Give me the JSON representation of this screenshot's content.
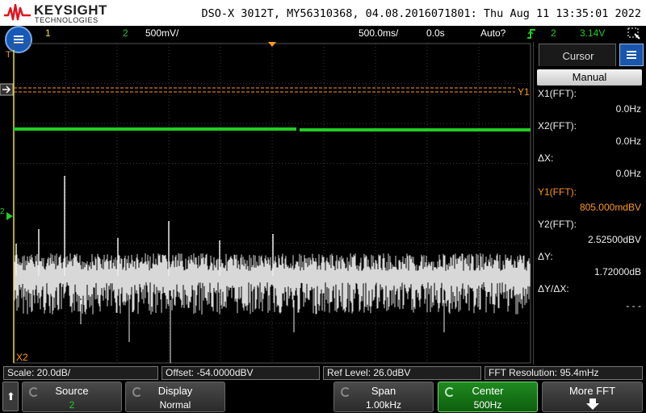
{
  "header": {
    "brand": "KEYSIGHT",
    "brand_sub": "TECHNOLOGIES",
    "title": "DSO-X 3012T, MY56310368, 04.08.2016071801: Thu Aug 11 13:35:01 2022"
  },
  "status": {
    "ch1_num": "1",
    "ch2_num": "2",
    "ch2_scale": "500mV/",
    "timebase": "500.0ms/",
    "delay": "0.0s",
    "trigger_mode": "Auto?",
    "trigger_source": "2",
    "trigger_level": "3.14V"
  },
  "markers": {
    "y1": "Y1",
    "x2": "X2",
    "trig": "T",
    "ch2": "2"
  },
  "cursor_panel": {
    "tab_label": "Cursor",
    "mode": "Manual",
    "readouts": [
      {
        "label": "X1(FFT):",
        "value": "0.0Hz"
      },
      {
        "label": "X2(FFT):",
        "value": "0.0Hz"
      },
      {
        "label": "ΔX:",
        "value": "0.0Hz"
      },
      {
        "label": "Y1(FFT):",
        "value": "805.000mdBV"
      },
      {
        "label": "Y2(FFT):",
        "value": "2.52500dBV"
      },
      {
        "label": "ΔY:",
        "value": "1.72000dB"
      },
      {
        "label": "ΔY/ΔX:",
        "value": "- - -"
      }
    ]
  },
  "info": {
    "scale": "Scale: 20.0dB/",
    "offset": "Offset: -54.0000dBV",
    "ref_level": "Ref Level: 26.0dBV",
    "fft_resolution": "FFT Resolution: 95.4mHz"
  },
  "softkeys": {
    "source": {
      "title": "Source",
      "value": "2"
    },
    "display": {
      "title": "Display",
      "value": "Normal"
    },
    "span": {
      "title": "Span",
      "value": "1.00kHz"
    },
    "center": {
      "title": "Center",
      "value": "500Hz"
    },
    "more": {
      "title": "More FFT"
    }
  },
  "colors": {
    "channel1": "#f0e020",
    "channel2": "#22cc22",
    "fft": "#d8d8d8",
    "cursor_y1": "#ff9a1a",
    "accent_blue": "#1659b8"
  },
  "icons": [
    "keysight-logo-icon",
    "menu-icon",
    "trigger-edge-icon",
    "touch-lock-icon",
    "knob-icon",
    "back-arrow-icon",
    "down-arrow-icon"
  ]
}
